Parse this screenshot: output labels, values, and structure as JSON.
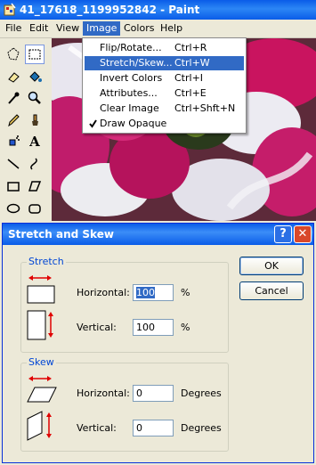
{
  "window": {
    "title": "41_17618_1199952842 - Paint"
  },
  "menubar": {
    "items": [
      "File",
      "Edit",
      "View",
      "Image",
      "Colors",
      "Help"
    ]
  },
  "image_menu": {
    "items": [
      {
        "label": "Flip/Rotate...",
        "shortcut": "Ctrl+R"
      },
      {
        "label": "Stretch/Skew...",
        "shortcut": "Ctrl+W"
      },
      {
        "label": "Invert Colors",
        "shortcut": "Ctrl+I"
      },
      {
        "label": "Attributes...",
        "shortcut": "Ctrl+E"
      },
      {
        "label": "Clear Image",
        "shortcut": "Ctrl+Shft+N"
      },
      {
        "label": "Draw Opaque",
        "shortcut": ""
      }
    ],
    "highlighted": "Stretch/Skew...",
    "checked": "Draw Opaque"
  },
  "tools": [
    "free-select-icon",
    "select-icon",
    "eraser-icon",
    "fill-icon",
    "color-picker-icon",
    "magnifier-icon",
    "pencil-icon",
    "brush-icon",
    "airbrush-icon",
    "text-icon",
    "line-icon",
    "curve-icon",
    "rectangle-icon",
    "polygon-icon",
    "ellipse-icon",
    "rounded-rect-icon"
  ],
  "dialog": {
    "title": "Stretch and Skew",
    "help_glyph": "?",
    "close_glyph": "✕",
    "stretch": {
      "label": "Stretch",
      "horizontal_label": "Horizontal:",
      "horizontal_value": "100",
      "horizontal_unit": "%",
      "vertical_label": "Vertical:",
      "vertical_value": "100",
      "vertical_unit": "%"
    },
    "skew": {
      "label": "Skew",
      "horizontal_label": "Horizontal:",
      "horizontal_value": "0",
      "horizontal_unit": "Degrees",
      "vertical_label": "Vertical:",
      "vertical_value": "0",
      "vertical_unit": "Degrees"
    },
    "ok_label": "OK",
    "cancel_label": "Cancel"
  },
  "colors": {
    "accent": "#316ac5",
    "titlebar": "#0a5ce8",
    "arrow_red": "#e00000",
    "group_label": "#0046d5"
  }
}
